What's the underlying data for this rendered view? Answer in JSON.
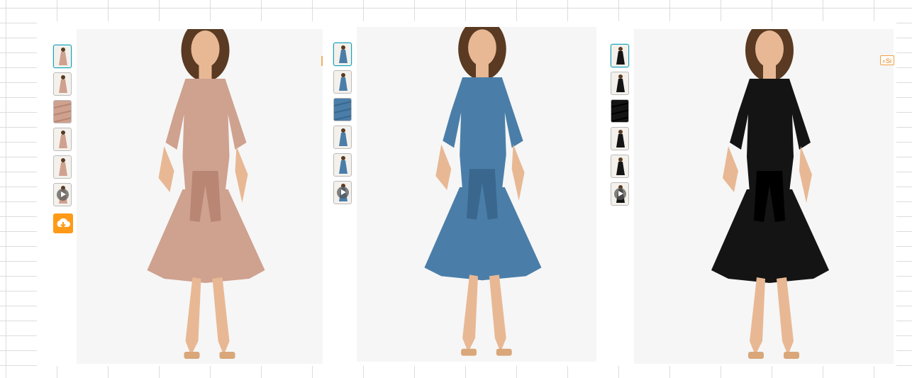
{
  "products": [
    {
      "color_name": "blush",
      "dress_color": "#cfa18f",
      "dress_shadow": "#b88673",
      "thumbnails": [
        {
          "icon": "dress-front-thumb"
        },
        {
          "icon": "dress-detail-thumb"
        },
        {
          "icon": "fabric-closeup-thumb"
        },
        {
          "icon": "dress-side-thumb"
        },
        {
          "icon": "dress-back-thumb"
        },
        {
          "icon": "video-thumb",
          "video": true
        }
      ],
      "has_download": true
    },
    {
      "color_name": "blue",
      "dress_color": "#4a7ea9",
      "dress_shadow": "#3a678d",
      "thumbnails": [
        {
          "icon": "dress-front-thumb"
        },
        {
          "icon": "dress-detail-thumb"
        },
        {
          "icon": "fabric-closeup-thumb"
        },
        {
          "icon": "dress-side-thumb"
        },
        {
          "icon": "dress-back-thumb"
        },
        {
          "icon": "video-thumb",
          "video": true
        }
      ]
    },
    {
      "color_name": "black",
      "dress_color": "#141414",
      "dress_shadow": "#000000",
      "thumbnails": [
        {
          "icon": "dress-front-thumb"
        },
        {
          "icon": "dress-detail-thumb"
        },
        {
          "icon": "fabric-closeup-thumb"
        },
        {
          "icon": "dress-side-thumb"
        },
        {
          "icon": "dress-back-thumb"
        },
        {
          "icon": "video-thumb",
          "video": true
        }
      ],
      "zoom_label": "Si"
    }
  ],
  "colors": {
    "accent": "#ff9a18",
    "selected_border": "#17a2b8",
    "image_bg": "#f6f6f6",
    "skin": "#e8b894",
    "hair": "#5a3a22",
    "sandal": "#d9a77a"
  }
}
